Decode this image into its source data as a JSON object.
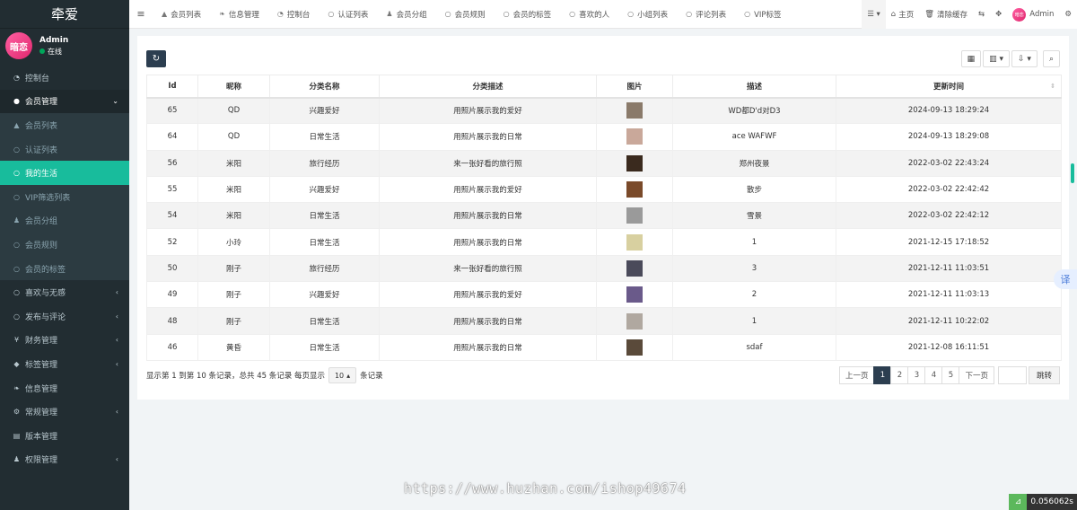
{
  "brand": "牵爱",
  "user": {
    "name": "Admin",
    "status": "在线",
    "avatar_text": "暗恋"
  },
  "sidebar": [
    {
      "label": "控制台",
      "icon": "dashboard-icon",
      "glyph": "◔",
      "state": "normal",
      "arrow": ""
    },
    {
      "label": "会员管理",
      "icon": "user-circle-icon",
      "glyph": "●",
      "state": "open",
      "arrow": "⌄"
    },
    {
      "label": "会员列表",
      "icon": "user-icon",
      "glyph": "▲",
      "state": "sub",
      "arrow": ""
    },
    {
      "label": "认证列表",
      "icon": "circle-icon",
      "glyph": "○",
      "state": "sub",
      "arrow": ""
    },
    {
      "label": "我的生活",
      "icon": "circle-icon",
      "glyph": "○",
      "state": "active",
      "arrow": ""
    },
    {
      "label": "VIP筛选列表",
      "icon": "circle-icon",
      "glyph": "○",
      "state": "sub",
      "arrow": ""
    },
    {
      "label": "会员分组",
      "icon": "users-icon",
      "glyph": "♟",
      "state": "sub",
      "arrow": ""
    },
    {
      "label": "会员规则",
      "icon": "circle-icon",
      "glyph": "○",
      "state": "sub",
      "arrow": ""
    },
    {
      "label": "会员的标签",
      "icon": "circle-icon",
      "glyph": "○",
      "state": "sub",
      "arrow": ""
    },
    {
      "label": "喜欢与无感",
      "icon": "circle-icon",
      "glyph": "○",
      "state": "normal",
      "arrow": "‹"
    },
    {
      "label": "发布与评论",
      "icon": "circle-icon",
      "glyph": "○",
      "state": "normal",
      "arrow": "‹"
    },
    {
      "label": "财务管理",
      "icon": "yen-icon",
      "glyph": "¥",
      "state": "normal",
      "arrow": "‹"
    },
    {
      "label": "标签管理",
      "icon": "tag-icon",
      "glyph": "◆",
      "state": "normal",
      "arrow": "‹"
    },
    {
      "label": "信息管理",
      "icon": "leaf-icon",
      "glyph": "❧",
      "state": "normal",
      "arrow": ""
    },
    {
      "label": "常规管理",
      "icon": "cogs-icon",
      "glyph": "⚙",
      "state": "normal",
      "arrow": "‹"
    },
    {
      "label": "版本管理",
      "icon": "file-icon",
      "glyph": "▤",
      "state": "normal",
      "arrow": ""
    },
    {
      "label": "权限管理",
      "icon": "group-icon",
      "glyph": "♟",
      "state": "normal",
      "arrow": "‹"
    }
  ],
  "topnav": {
    "tabs": [
      {
        "label": "会员列表",
        "icon": "user-icon",
        "glyph": "▲"
      },
      {
        "label": "信息管理",
        "icon": "leaf-icon",
        "glyph": "❧"
      },
      {
        "label": "控制台",
        "icon": "dashboard-icon",
        "glyph": "◔"
      },
      {
        "label": "认证列表",
        "icon": "circle-icon",
        "glyph": "○"
      },
      {
        "label": "会员分组",
        "icon": "users-icon",
        "glyph": "♟"
      },
      {
        "label": "会员规则",
        "icon": "circle-icon",
        "glyph": "○"
      },
      {
        "label": "会员的标签",
        "icon": "circle-icon",
        "glyph": "○"
      },
      {
        "label": "喜欢的人",
        "icon": "circle-icon",
        "glyph": "○"
      },
      {
        "label": "小组列表",
        "icon": "circle-icon",
        "glyph": "○"
      },
      {
        "label": "评论列表",
        "icon": "circle-icon",
        "glyph": "○"
      },
      {
        "label": "VIP标签",
        "icon": "circle-icon",
        "glyph": "○"
      }
    ],
    "home": "主页",
    "clear_cache": "清除缓存",
    "admin": "Admin"
  },
  "table": {
    "columns": [
      "Id",
      "昵称",
      "分类名称",
      "分类描述",
      "图片",
      "描述",
      "更新时间"
    ],
    "rows": [
      {
        "id": "65",
        "nick": "QD",
        "cat": "兴趣爱好",
        "catdesc": "用照片展示我的爱好",
        "img": "#8a7a6a",
        "desc": "WD都D'd对D3",
        "time": "2024-09-13 18:29:24"
      },
      {
        "id": "64",
        "nick": "QD",
        "cat": "日常生活",
        "catdesc": "用照片展示我的日常",
        "img": "#c9a89a",
        "desc": "ace WAFWF",
        "time": "2024-09-13 18:29:08"
      },
      {
        "id": "56",
        "nick": "米阳",
        "cat": "旅行经历",
        "catdesc": "来一张好看的旅行照",
        "img": "#3a2a1e",
        "desc": "郑州夜景",
        "time": "2022-03-02 22:43:24"
      },
      {
        "id": "55",
        "nick": "米阳",
        "cat": "兴趣爱好",
        "catdesc": "用照片展示我的爱好",
        "img": "#7a4a2a",
        "desc": "散步",
        "time": "2022-03-02 22:42:42"
      },
      {
        "id": "54",
        "nick": "米阳",
        "cat": "日常生活",
        "catdesc": "用照片展示我的日常",
        "img": "#9a9a9a",
        "desc": "雪景",
        "time": "2022-03-02 22:42:12"
      },
      {
        "id": "52",
        "nick": "小玲",
        "cat": "日常生活",
        "catdesc": "用照片展示我的日常",
        "img": "#d8d0a0",
        "desc": "1",
        "time": "2021-12-15 17:18:52"
      },
      {
        "id": "50",
        "nick": "刚子",
        "cat": "旅行经历",
        "catdesc": "来一张好看的旅行照",
        "img": "#4a4a5a",
        "desc": "3",
        "time": "2021-12-11 11:03:51"
      },
      {
        "id": "49",
        "nick": "刚子",
        "cat": "兴趣爱好",
        "catdesc": "用照片展示我的爱好",
        "img": "#6a5a8a",
        "desc": "2",
        "time": "2021-12-11 11:03:13"
      },
      {
        "id": "48",
        "nick": "刚子",
        "cat": "日常生活",
        "catdesc": "用照片展示我的日常",
        "img": "#b0a8a0",
        "desc": "1",
        "time": "2021-12-11 10:22:02"
      },
      {
        "id": "46",
        "nick": "黄昏",
        "cat": "日常生活",
        "catdesc": "用照片展示我的日常",
        "img": "#5a4a3a",
        "desc": "sdaf",
        "time": "2021-12-08 16:11:51"
      }
    ]
  },
  "footer": {
    "summary": "显示第 1 到第 10 条记录，总共 45 条记录 每页显示",
    "page_size": "10",
    "suffix": "条记录",
    "prev": "上一页",
    "pages": [
      "1",
      "2",
      "3",
      "4",
      "5"
    ],
    "current_page": "1",
    "next": "下一页",
    "jump": "跳转"
  },
  "watermark": "https://www.huzhan.com/ishop49674",
  "timer": "0.056062s",
  "translate": "译"
}
